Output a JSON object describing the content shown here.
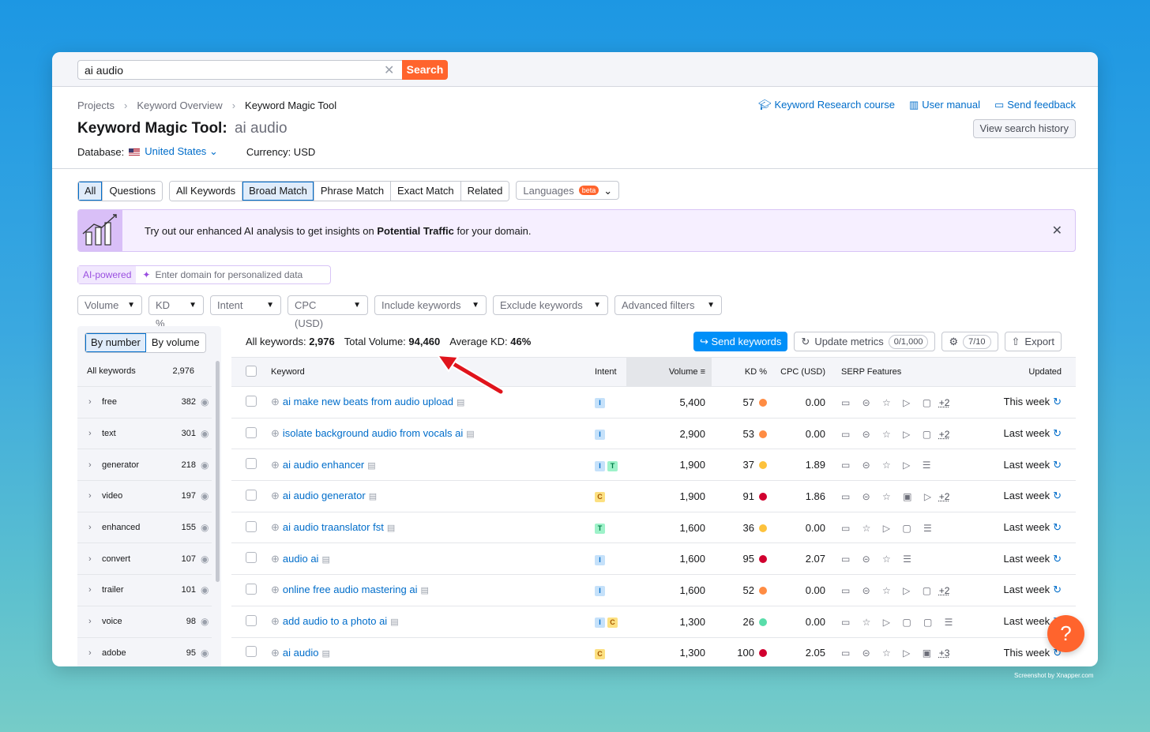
{
  "search": {
    "value": "ai audio",
    "button_label": "Search"
  },
  "breadcrumb": [
    "Projects",
    "Keyword Overview",
    "Keyword Magic Tool"
  ],
  "title": {
    "label": "Keyword Magic Tool:",
    "query": "ai audio"
  },
  "database": {
    "label": "Database:",
    "country": "United States",
    "currency_label": "Currency: USD"
  },
  "header_links": [
    {
      "icon": "graduation-cap-icon",
      "label": "Keyword Research course"
    },
    {
      "icon": "book-icon",
      "label": "User manual"
    },
    {
      "icon": "feedback-icon",
      "label": "Send feedback"
    }
  ],
  "history_button": "View search history",
  "tabs": {
    "group1": [
      "All",
      "Questions"
    ],
    "group2": [
      "All Keywords",
      "Broad Match",
      "Phrase Match",
      "Exact Match",
      "Related"
    ],
    "languages": "Languages",
    "beta": "beta"
  },
  "promo": {
    "text_before": "Try out our enhanced AI analysis to get insights on ",
    "text_bold": "Potential Traffic",
    "text_after": " for your domain."
  },
  "ai": {
    "badge": "AI-powered",
    "placeholder": "Enter domain for personalized data"
  },
  "filters": [
    "Volume",
    "KD %",
    "Intent",
    "CPC (USD)",
    "Include keywords",
    "Exclude keywords",
    "Advanced filters"
  ],
  "sidebar": {
    "toggle": [
      "By number",
      "By volume"
    ],
    "all_label": "All keywords",
    "all_count": "2,976",
    "items": [
      {
        "name": "free",
        "count": "382"
      },
      {
        "name": "text",
        "count": "301"
      },
      {
        "name": "generator",
        "count": "218"
      },
      {
        "name": "video",
        "count": "197"
      },
      {
        "name": "enhanced",
        "count": "155"
      },
      {
        "name": "convert",
        "count": "107"
      },
      {
        "name": "trailer",
        "count": "101"
      },
      {
        "name": "voice",
        "count": "98"
      },
      {
        "name": "adobe",
        "count": "95"
      }
    ]
  },
  "summary": {
    "all_label": "All keywords:",
    "all_value": "2,976",
    "volume_label": "Total Volume:",
    "volume_value": "94,460",
    "kd_label": "Average KD:",
    "kd_value": "46%"
  },
  "actions": {
    "send": "Send keywords",
    "update": "Update metrics",
    "update_pill": "0/1,000",
    "settings_pill": "7/10",
    "export": "Export"
  },
  "table": {
    "headers": {
      "keyword": "Keyword",
      "intent": "Intent",
      "volume": "Volume",
      "kd": "KD %",
      "cpc": "CPC (USD)",
      "serp": "SERP Features",
      "updated": "Updated"
    },
    "rows": [
      {
        "keyword": "ai make new beats from audio upload",
        "intent": [
          "I"
        ],
        "volume": "5,400",
        "kd": "57",
        "kd_color": "#ff8c43",
        "cpc": "0.00",
        "serp": "▭ ⊝ ☆ ▷ ▢",
        "more": "+2",
        "updated": "This week"
      },
      {
        "keyword": "isolate background audio from vocals ai",
        "intent": [
          "I"
        ],
        "volume": "2,900",
        "kd": "53",
        "kd_color": "#ff8c43",
        "cpc": "0.00",
        "serp": "▭ ⊝ ☆ ▷ ▢",
        "more": "+2",
        "updated": "Last week"
      },
      {
        "keyword": "ai audio enhancer",
        "intent": [
          "I",
          "T"
        ],
        "volume": "1,900",
        "kd": "37",
        "kd_color": "#fdc23c",
        "cpc": "1.89",
        "serp": "▭ ⊝ ☆ ▷ ☰",
        "more": "",
        "updated": "Last week"
      },
      {
        "keyword": "ai audio generator",
        "intent": [
          "C"
        ],
        "volume": "1,900",
        "kd": "91",
        "kd_color": "#d1002f",
        "cpc": "1.86",
        "serp": "▭ ⊝ ☆ ▣ ▷",
        "more": "+2",
        "updated": "Last week"
      },
      {
        "keyword": "ai audio traanslator fst",
        "intent": [
          "T"
        ],
        "volume": "1,600",
        "kd": "36",
        "kd_color": "#fdc23c",
        "cpc": "0.00",
        "serp": "▭ ☆ ▷ ▢ ☰",
        "more": "",
        "updated": "Last week"
      },
      {
        "keyword": "audio ai",
        "intent": [
          "I"
        ],
        "volume": "1,600",
        "kd": "95",
        "kd_color": "#d1002f",
        "cpc": "2.07",
        "serp": "▭ ⊝ ☆ ☰",
        "more": "",
        "updated": "Last week"
      },
      {
        "keyword": "online free audio mastering ai",
        "intent": [
          "I"
        ],
        "volume": "1,600",
        "kd": "52",
        "kd_color": "#ff8c43",
        "cpc": "0.00",
        "serp": "▭ ⊝ ☆ ▷ ▢",
        "more": "+2",
        "updated": "Last week"
      },
      {
        "keyword": "add audio to a photo ai",
        "intent": [
          "I",
          "C"
        ],
        "volume": "1,300",
        "kd": "26",
        "kd_color": "#59ddaa",
        "cpc": "0.00",
        "serp": "▭ ☆ ▷ ▢ ▢ ☰",
        "more": "",
        "updated": "Last week"
      },
      {
        "keyword": "ai audio",
        "intent": [
          "C"
        ],
        "volume": "1,300",
        "kd": "100",
        "kd_color": "#d1002f",
        "cpc": "2.05",
        "serp": "▭ ⊝ ☆ ▷ ▣",
        "more": "+3",
        "updated": "This week"
      }
    ]
  },
  "help_label": "?",
  "watermark": "Screenshot by Xnapper.com"
}
